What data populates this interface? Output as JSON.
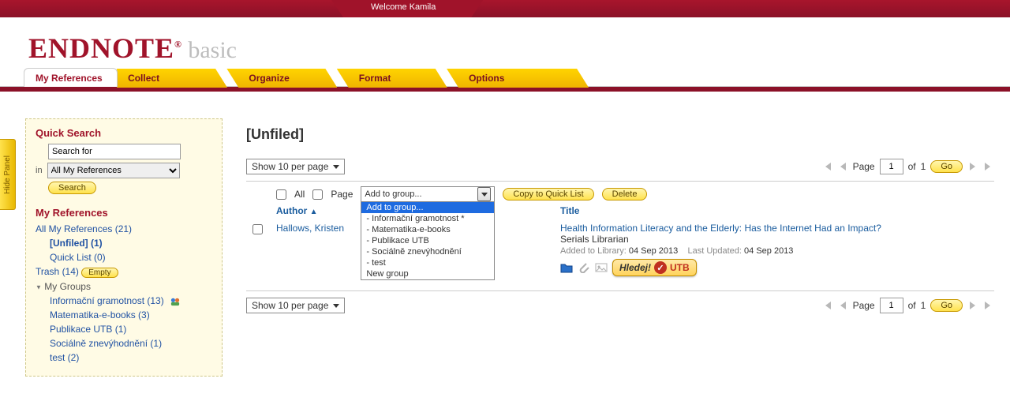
{
  "header": {
    "welcome": "Welcome Kamila"
  },
  "logo": {
    "main": "ENDNOTE",
    "reg": "®",
    "sub": "basic"
  },
  "tabs": {
    "my_references": "My References",
    "collect": "Collect",
    "organize": "Organize",
    "format": "Format",
    "options": "Options"
  },
  "hide_panel": "Hide Panel",
  "quick_search": {
    "title": "Quick Search",
    "placeholder": "Search for",
    "in_label": "in",
    "scope": "All My References",
    "button": "Search"
  },
  "my_refs": {
    "title": "My References",
    "all": "All My References (21)",
    "unfiled": "[Unfiled] (1)",
    "quicklist": "Quick List (0)",
    "trash": "Trash (14)",
    "empty": "Empty",
    "groups_header": "My Groups",
    "groups": [
      "Informační gramotnost (13)",
      "Matematika-e-books (3)",
      "Publikace UTB (1)",
      "Sociálně znevýhodnění (1)",
      "test (2)"
    ]
  },
  "main": {
    "title": "[Unfiled]",
    "show_per_page": "Show 10 per page",
    "select": {
      "all": "All",
      "page": "Page"
    },
    "dropdown": {
      "label": "Add to group...",
      "options": [
        "Add to group...",
        "- Informační gramotnost *",
        "- Matematika-e-books",
        "- Publikace UTB",
        "- Sociálně znevýhodnění",
        "- test",
        "New group"
      ]
    },
    "copy_btn": "Copy to Quick List",
    "delete_btn": "Delete",
    "columns": {
      "author": "Author",
      "title": "Title"
    },
    "record": {
      "author": "Hallows, Kristen",
      "title": "Health Information Literacy and the Elderly: Has the Internet Had an Impact?",
      "source": "Serials Librarian",
      "added_label": "Added to Library:",
      "added_date": "04 Sep 2013",
      "updated_label": "Last Updated:",
      "updated_date": "04 Sep 2013",
      "hledej": "Hledej!",
      "utb": "UTB"
    },
    "pager": {
      "page_label": "Page",
      "page": "1",
      "of_label": "of",
      "total": "1",
      "go": "Go"
    }
  }
}
